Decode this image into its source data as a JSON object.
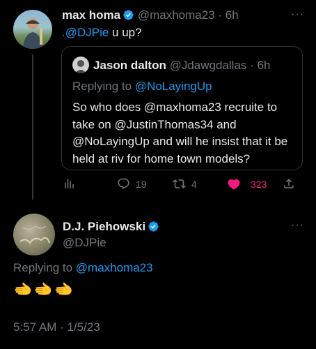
{
  "tweet1": {
    "name": "max homa",
    "handle": "@maxhoma23",
    "time": "6h",
    "mention": ".@DJPie",
    "text": " u up?",
    "quote": {
      "name": "Jason dalton",
      "handle": "@Jdawgdallas",
      "time": "6h",
      "replying_prefix": "Replying to ",
      "replying_handle": "@NoLayingUp",
      "body": "So who does @maxhoma23 recruite to take on @JustinThomas34 and @NoLayingUp and will he insist that it be held at riv for home town models?"
    },
    "actions": {
      "replies": "19",
      "retweets": "4",
      "likes": "323"
    },
    "more_icon": "more-icon"
  },
  "tweet2": {
    "name": "D.J. Piehowski",
    "handle": "@DJPie",
    "replying_prefix": "Replying to ",
    "replying_handle": "@maxhoma23",
    "emoji": "🫲🫲🫲",
    "timestamp": "5:57 AM · 1/5/23"
  },
  "colors": {
    "accent": "#1d9bf0",
    "like": "#f91880",
    "muted": "#71767b",
    "border": "#2f3336"
  }
}
